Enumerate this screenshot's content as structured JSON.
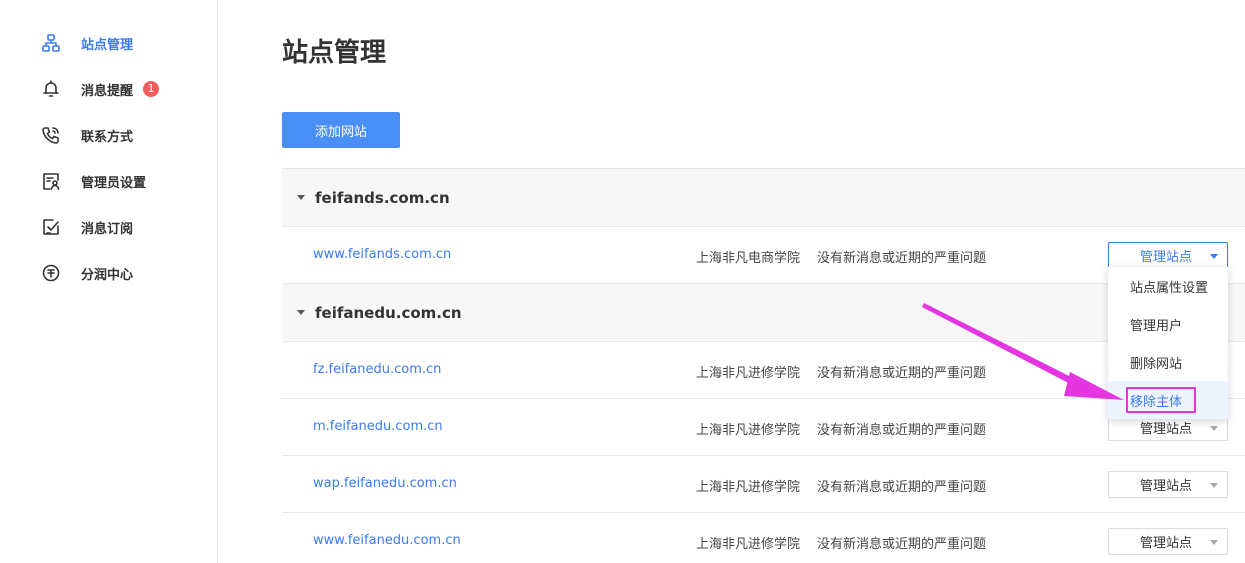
{
  "sidebar": {
    "items": [
      {
        "label": "站点管理",
        "icon": "sitemap-icon",
        "active": true
      },
      {
        "label": "消息提醒",
        "icon": "bell-icon",
        "badge": "1"
      },
      {
        "label": "联系方式",
        "icon": "phone-icon"
      },
      {
        "label": "管理员设置",
        "icon": "admin-icon"
      },
      {
        "label": "消息订阅",
        "icon": "subscribe-icon"
      },
      {
        "label": "分润中心",
        "icon": "revenue-icon"
      }
    ]
  },
  "main": {
    "title": "站点管理",
    "add_button": "添加网站",
    "groups": [
      {
        "name": "feifands.com.cn",
        "sites": [
          {
            "domain": "www.feifands.com.cn",
            "org": "上海非凡电商学院",
            "status": "没有新消息或近期的严重问题",
            "action": "管理站点"
          }
        ]
      },
      {
        "name": "feifanedu.com.cn",
        "sites": [
          {
            "domain": "fz.feifanedu.com.cn",
            "org": "上海非凡进修学院",
            "status": "没有新消息或近期的严重问题",
            "action": "管理站点"
          },
          {
            "domain": "m.feifanedu.com.cn",
            "org": "上海非凡进修学院",
            "status": "没有新消息或近期的严重问题",
            "action": "管理站点"
          },
          {
            "domain": "wap.feifanedu.com.cn",
            "org": "上海非凡进修学院",
            "status": "没有新消息或近期的严重问题",
            "action": "管理站点"
          },
          {
            "domain": "www.feifanedu.com.cn",
            "org": "上海非凡进修学院",
            "status": "没有新消息或近期的严重问题",
            "action": "管理站点"
          }
        ]
      }
    ]
  },
  "dropdown": {
    "items": [
      "站点属性设置",
      "管理用户",
      "删除网站",
      "移除主体"
    ],
    "highlighted": "移除主体"
  },
  "colors": {
    "accent": "#3a7bf2",
    "button": "#4a8ff6",
    "badge": "#f05b5b",
    "annotation": "#e535e0"
  }
}
